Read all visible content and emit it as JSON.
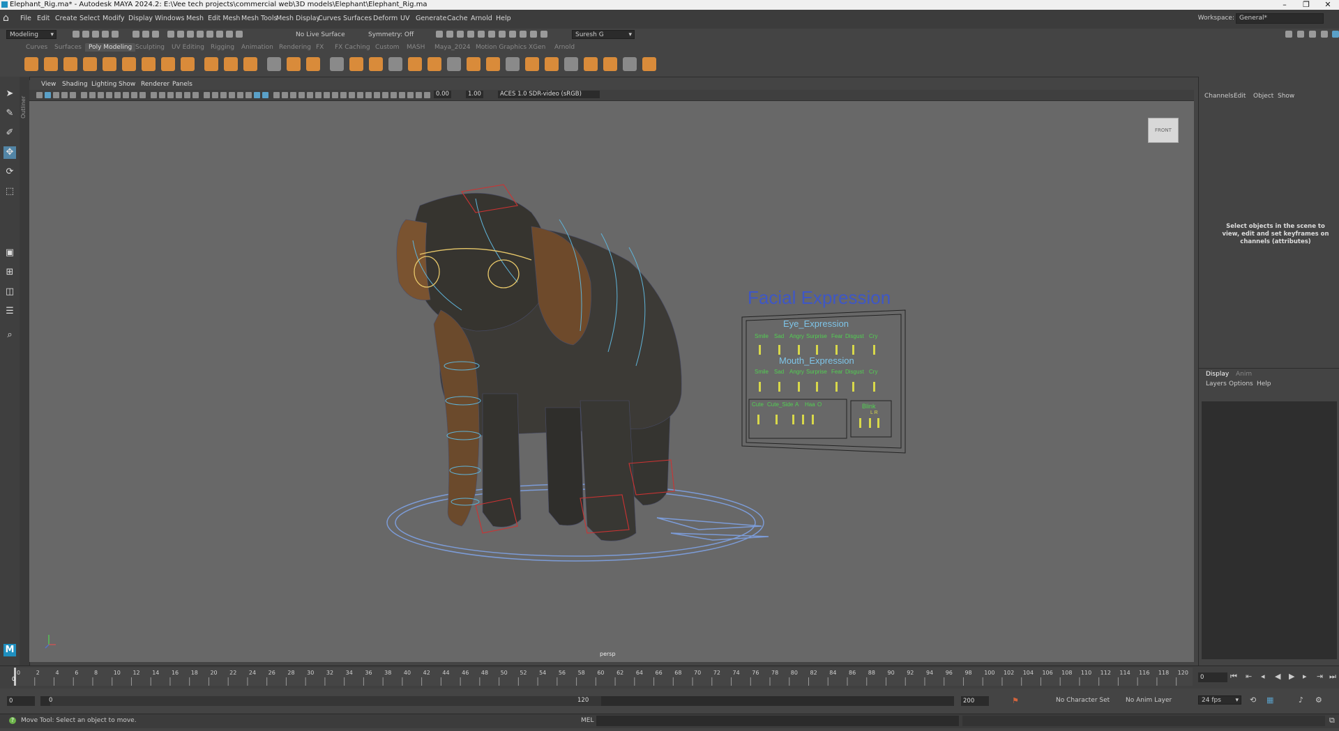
{
  "window": {
    "title": "Elephant_Rig.ma* - Autodesk MAYA 2024.2: E:\\Vee tech projects\\commercial web\\3D models\\Elephant\\Elephant_Rig.ma",
    "controls": [
      "–",
      "❐",
      "✕"
    ]
  },
  "menubar": {
    "items": [
      "File",
      "Edit",
      "Create",
      "Select",
      "Modify",
      "Display",
      "Windows",
      "Mesh",
      "Edit Mesh",
      "Mesh Tools",
      "Mesh Display",
      "Curves",
      "Surfaces",
      "Deform",
      "UV",
      "Generate",
      "Cache",
      "Arnold",
      "Help"
    ],
    "workspace_label": "Workspace:",
    "workspace_value": "General*"
  },
  "statusline": {
    "mode": "Modeling",
    "live_surface": "No Live Surface",
    "symmetry": "Symmetry: Off",
    "user": "Suresh G"
  },
  "shelf": {
    "tabs": [
      "Curves",
      "Surfaces",
      "Poly Modeling",
      "Sculpting",
      "UV Editing",
      "Rigging",
      "Animation",
      "Rendering",
      "FX",
      "FX Caching",
      "Custom",
      "MASH",
      "Maya_2024",
      "Motion Graphics",
      "XGen",
      "Arnold"
    ],
    "active_tab": "Poly Modeling",
    "icon_color": "#d98b3a"
  },
  "viewport": {
    "menu": [
      "View",
      "Shading",
      "Lighting",
      "Show",
      "Renderer",
      "Panels"
    ],
    "exposure": "0.00",
    "gamma": "1.00",
    "color_space": "ACES 1.0 SDR-video (sRGB)",
    "camera_label": "persp",
    "viewcube_label": "FRONT",
    "outliner_label": "Outliner",
    "facial_title": "Facial Expression",
    "eye_title": "Eye_Expression",
    "eye_labels": [
      "Smile",
      "Sad",
      "Angry",
      "Surprise",
      "Fear",
      "Disgust",
      "Cry"
    ],
    "mouth_title": "Mouth_Expression",
    "mouth_labels": [
      "Smile",
      "Sad",
      "Angry",
      "Surprise",
      "Fear",
      "Disgust",
      "Cry"
    ],
    "extra_labels": [
      "Cute",
      "Cute_Side",
      "A",
      "Haa",
      "O"
    ],
    "blink_label": "Blink",
    "blink_lr": "L R"
  },
  "right_panel": {
    "channel_tabs": [
      "Channels",
      "Edit",
      "Object",
      "Show"
    ],
    "message": "Select objects in the scene to view, edit and set keyframes on channels (attributes)",
    "layer_tabs": [
      "Display",
      "Anim"
    ],
    "layer_menu": [
      "Layers",
      "Options",
      "Help"
    ]
  },
  "timeline": {
    "ticks": [
      "0",
      "2",
      "4",
      "6",
      "8",
      "10",
      "12",
      "14",
      "16",
      "18",
      "20",
      "22",
      "24",
      "26",
      "28",
      "30",
      "32",
      "34",
      "36",
      "38",
      "40",
      "42",
      "44",
      "46",
      "48",
      "50",
      "52",
      "54",
      "56",
      "58",
      "60",
      "62",
      "64",
      "66",
      "68",
      "70",
      "72",
      "74",
      "76",
      "78",
      "80",
      "82",
      "84",
      "86",
      "88",
      "90",
      "92",
      "94",
      "96",
      "98",
      "100",
      "102",
      "104",
      "106",
      "108",
      "110",
      "112",
      "114",
      "116",
      "118",
      "120"
    ],
    "current_frame": "0",
    "current_frame_label": "0"
  },
  "range": {
    "start": "0",
    "inner_start": "0",
    "inner_end": "120",
    "end": "200",
    "character_set": "No Character Set",
    "anim_layer": "No Anim Layer",
    "fps": "24 fps"
  },
  "command": {
    "help": "Move Tool: Select an object to move.",
    "lang": "MEL"
  }
}
